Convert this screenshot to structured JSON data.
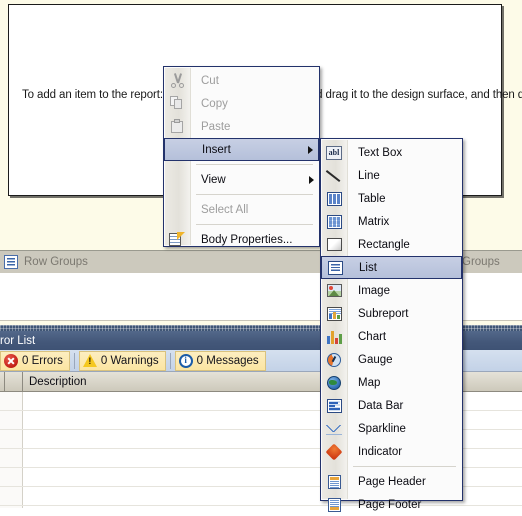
{
  "design_surface": {
    "hint_text": "To add an item to the report: click an item in the Toolbox and drag it to the design surface, and then drag datas"
  },
  "grouping_pane": {
    "row_groups_label": "Row Groups",
    "column_groups_label": "Groups",
    "row_groups_icon": "grouping-icon",
    "column_groups_icon": "grouping-icon"
  },
  "error_list": {
    "title": "ror List",
    "toolbar": [
      {
        "icon": "error-icon",
        "label": "0 Errors"
      },
      {
        "icon": "warning-icon",
        "label": "0 Warnings"
      },
      {
        "icon": "info-icon",
        "label": "0 Messages"
      }
    ],
    "columns": [
      "",
      "",
      "Description"
    ],
    "description_header": "Description",
    "rows": []
  },
  "context_menu": {
    "items": [
      {
        "label": "Cut",
        "icon": "cut-icon",
        "enabled": false,
        "submenu": false,
        "selected": false
      },
      {
        "label": "Copy",
        "icon": "copy-icon",
        "enabled": false,
        "submenu": false,
        "selected": false
      },
      {
        "label": "Paste",
        "icon": "paste-icon",
        "enabled": false,
        "submenu": false,
        "selected": false
      },
      {
        "label": "Insert",
        "icon": "",
        "enabled": true,
        "submenu": true,
        "selected": true
      },
      {
        "label": "View",
        "icon": "",
        "enabled": true,
        "submenu": true,
        "selected": false
      },
      {
        "label": "Select All",
        "icon": "",
        "enabled": false,
        "submenu": false,
        "selected": false
      },
      {
        "label": "Body Properties...",
        "icon": "body-properties-icon",
        "enabled": true,
        "submenu": false,
        "selected": false
      }
    ]
  },
  "insert_submenu": {
    "items": [
      {
        "label": "Text Box",
        "icon": "textbox-icon",
        "selected": false
      },
      {
        "label": "Line",
        "icon": "line-icon",
        "selected": false
      },
      {
        "label": "Table",
        "icon": "table-icon",
        "selected": false
      },
      {
        "label": "Matrix",
        "icon": "matrix-icon",
        "selected": false
      },
      {
        "label": "Rectangle",
        "icon": "rectangle-icon",
        "selected": false
      },
      {
        "label": "List",
        "icon": "list-icon",
        "selected": true
      },
      {
        "label": "Image",
        "icon": "image-icon",
        "selected": false
      },
      {
        "label": "Subreport",
        "icon": "subreport-icon",
        "selected": false
      },
      {
        "label": "Chart",
        "icon": "chart-icon",
        "selected": false
      },
      {
        "label": "Gauge",
        "icon": "gauge-icon",
        "selected": false
      },
      {
        "label": "Map",
        "icon": "map-icon",
        "selected": false
      },
      {
        "label": "Data Bar",
        "icon": "data-bar-icon",
        "selected": false
      },
      {
        "label": "Sparkline",
        "icon": "sparkline-icon",
        "selected": false
      },
      {
        "label": "Indicator",
        "icon": "indicator-icon",
        "selected": false
      },
      {
        "label": "Page Header",
        "icon": "page-header-icon",
        "selected": false
      },
      {
        "label": "Page Footer",
        "icon": "page-footer-icon",
        "selected": false
      }
    ]
  },
  "colors": {
    "design_background": "#fdfbe8",
    "menu_background": "#fbfbfb",
    "menu_border": "#23326b",
    "menu_highlight": "#b5c0da",
    "panel_title_bar": "#44587a",
    "toolbar_toggle": "#fbe5a2",
    "grouping_header": "#ccc9bd",
    "error_red": "#c01d14",
    "warning_yellow": "#f5c820",
    "info_blue": "#1b5ca8"
  }
}
